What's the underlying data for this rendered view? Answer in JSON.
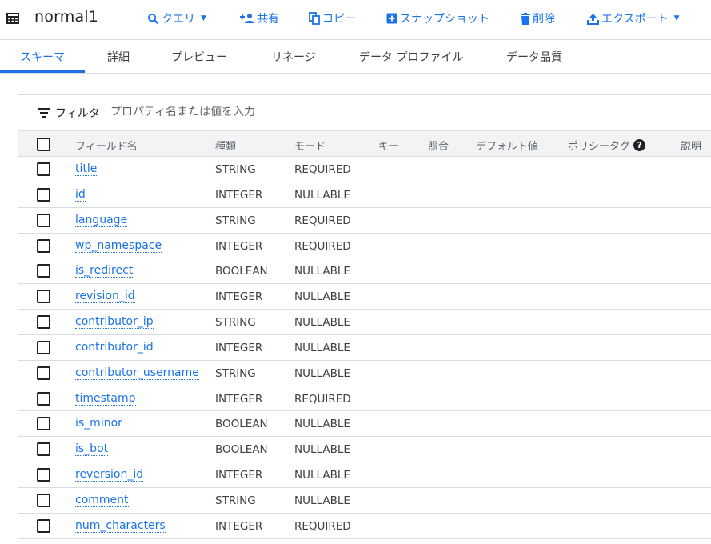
{
  "header": {
    "title": "normal1",
    "actions": [
      {
        "label": "クエリ",
        "icon": "search-icon",
        "dropdown": true
      },
      {
        "label": "共有",
        "icon": "person-add-icon",
        "dropdown": false
      },
      {
        "label": "コピー",
        "icon": "copy-icon",
        "dropdown": false
      },
      {
        "label": "スナップショット",
        "icon": "snapshot-icon",
        "dropdown": false
      },
      {
        "label": "削除",
        "icon": "trash-icon",
        "dropdown": false
      },
      {
        "label": "エクスポート",
        "icon": "upload-icon",
        "dropdown": true
      }
    ]
  },
  "tabs": [
    {
      "label": "スキーマ",
      "active": true
    },
    {
      "label": "詳細",
      "active": false
    },
    {
      "label": "プレビュー",
      "active": false
    },
    {
      "label": "リネージ",
      "active": false
    },
    {
      "label": "データ プロファイル",
      "active": false
    },
    {
      "label": "データ品質",
      "active": false
    }
  ],
  "filter": {
    "label": "フィルタ",
    "placeholder": "プロパティ名または値を入力"
  },
  "table": {
    "columns": [
      "フィールド名",
      "種類",
      "モード",
      "キー",
      "照合",
      "デフォルト値",
      "ポリシータグ",
      "説明"
    ],
    "rows": [
      {
        "name": "title",
        "type": "STRING",
        "mode": "REQUIRED"
      },
      {
        "name": "id",
        "type": "INTEGER",
        "mode": "NULLABLE"
      },
      {
        "name": "language",
        "type": "STRING",
        "mode": "REQUIRED"
      },
      {
        "name": "wp_namespace",
        "type": "INTEGER",
        "mode": "REQUIRED"
      },
      {
        "name": "is_redirect",
        "type": "BOOLEAN",
        "mode": "NULLABLE"
      },
      {
        "name": "revision_id",
        "type": "INTEGER",
        "mode": "NULLABLE"
      },
      {
        "name": "contributor_ip",
        "type": "STRING",
        "mode": "NULLABLE"
      },
      {
        "name": "contributor_id",
        "type": "INTEGER",
        "mode": "NULLABLE"
      },
      {
        "name": "contributor_username",
        "type": "STRING",
        "mode": "NULLABLE"
      },
      {
        "name": "timestamp",
        "type": "INTEGER",
        "mode": "REQUIRED"
      },
      {
        "name": "is_minor",
        "type": "BOOLEAN",
        "mode": "NULLABLE"
      },
      {
        "name": "is_bot",
        "type": "BOOLEAN",
        "mode": "NULLABLE"
      },
      {
        "name": "reversion_id",
        "type": "INTEGER",
        "mode": "NULLABLE"
      },
      {
        "name": "comment",
        "type": "STRING",
        "mode": "NULLABLE"
      },
      {
        "name": "num_characters",
        "type": "INTEGER",
        "mode": "REQUIRED"
      }
    ]
  },
  "colors": {
    "accent": "#1a73e8",
    "border": "#dadce0",
    "header_bg": "#f1f3f4"
  }
}
